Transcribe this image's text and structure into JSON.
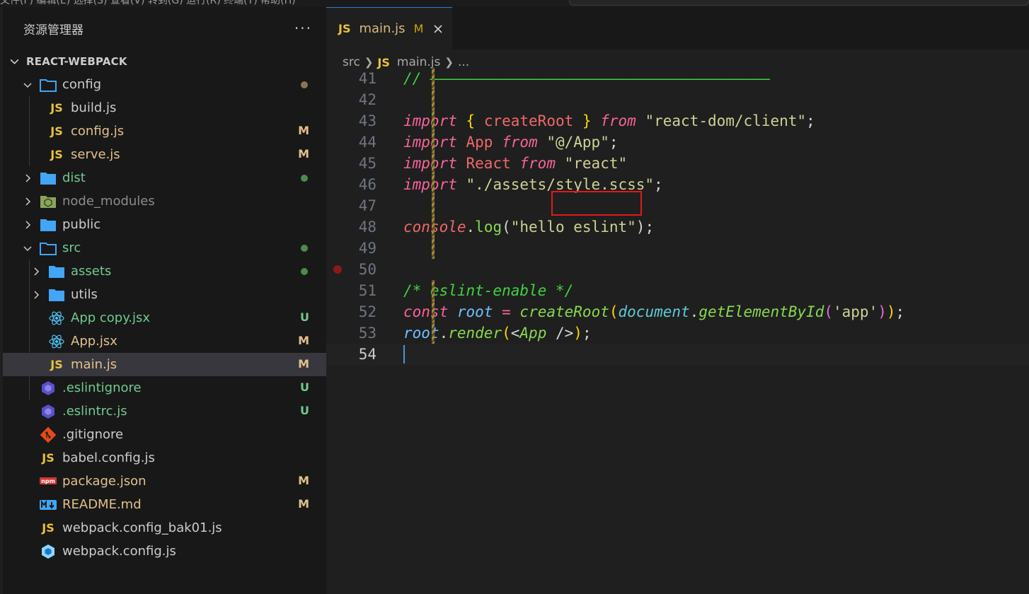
{
  "topbar": {
    "menu": "文件(F)   编辑(E)   选择(S)   查看(V)   转到(G)   运行(R)   终端(T)   帮助(H)"
  },
  "explorer": {
    "title": "资源管理器",
    "more": "···",
    "project": "REACT-WEBPACK",
    "tree": [
      {
        "label": "config",
        "type": "folder-open",
        "badge": "",
        "dot": "#8b7355"
      },
      {
        "label": "build.js",
        "type": "js",
        "badge": ""
      },
      {
        "label": "config.js",
        "type": "js",
        "badge": "M"
      },
      {
        "label": "serve.js",
        "type": "js",
        "badge": "M"
      },
      {
        "label": "dist",
        "type": "folder",
        "dot": "#4e8a4e"
      },
      {
        "label": "node_modules",
        "type": "node"
      },
      {
        "label": "public",
        "type": "folder"
      },
      {
        "label": "src",
        "type": "folder-open",
        "dot": "#4e8a4e"
      },
      {
        "label": "assets",
        "type": "folder",
        "dot": "#4e8a4e"
      },
      {
        "label": "utils",
        "type": "folder"
      },
      {
        "label": "App copy.jsx",
        "type": "react",
        "badge": "U"
      },
      {
        "label": "App.jsx",
        "type": "react",
        "badge": "M"
      },
      {
        "label": "main.js",
        "type": "js",
        "badge": "M"
      },
      {
        "label": ".eslintignore",
        "type": "eslint",
        "badge": "U"
      },
      {
        "label": ".eslintrc.js",
        "type": "eslint",
        "badge": "U"
      },
      {
        "label": ".gitignore",
        "type": "git"
      },
      {
        "label": "babel.config.js",
        "type": "js"
      },
      {
        "label": "package.json",
        "type": "npm",
        "badge": "M"
      },
      {
        "label": "README.md",
        "type": "md",
        "badge": "M"
      },
      {
        "label": "webpack.config_bak01.js",
        "type": "js"
      },
      {
        "label": "webpack.config.js",
        "type": "webpack"
      }
    ]
  },
  "editor": {
    "tab": {
      "icon": "JS",
      "label": "main.js",
      "modified": "M"
    },
    "breadcrumb": {
      "folder": "src",
      "icon": "JS",
      "file": "main.js",
      "more": "..."
    },
    "line_numbers": [
      "41",
      "42",
      "43",
      "44",
      "45",
      "46",
      "47",
      "48",
      "49",
      "50",
      "51",
      "52",
      "53",
      "54"
    ],
    "colors": {
      "keyword": "#f7649a",
      "string": "#ced195",
      "comment": "#3ed43e",
      "function": "#89d84f",
      "accent": "#2b7bd6",
      "highlight": "#e21a1a"
    }
  },
  "code": {
    "l41_comment": "// ——————————————————————————————————————",
    "l43_import": "import",
    "l43_ob": "{",
    "l43_name": "createRoot",
    "l43_cb": "}",
    "l43_from": "from",
    "l43_str": "\"react-dom/client\"",
    "l43_semi": ";",
    "l44_import": "import",
    "l44_name": "App",
    "l44_from": "from",
    "l44_str": "\"@/App\"",
    "l44_semi": ";",
    "l45_import": "import",
    "l45_name": "React",
    "l45_from": "from",
    "l45_str": "\"react\"",
    "l46_import": "import",
    "l46_str": "\"./assets/style.scss\"",
    "l46_semi": ";",
    "l48_obj": "console",
    "l48_dot": ".",
    "l48_fn": "log",
    "l48_op": "(",
    "l48_str": "\"hello eslint\"",
    "l48_cp": ")",
    "l48_semi": ";",
    "l51_comment": "/* eslint-enable */",
    "l52_const": "const",
    "l52_var": "root",
    "l52_eq": "=",
    "l52_fn": "createRoot",
    "l52_op1": "(",
    "l52_doc": "document",
    "l52_dot": ".",
    "l52_fn2": "getElementById",
    "l52_op2": "(",
    "l52_str": "'app'",
    "l52_cp2": ")",
    "l52_cp1": ")",
    "l52_semi": ";",
    "l53_var": "root",
    "l53_dot": ".",
    "l53_fn": "render",
    "l53_op": "(",
    "l53_lt": "<",
    "l53_tag": "App",
    "l53_close": "/>",
    "l53_cp": ")",
    "l53_semi": ";"
  }
}
